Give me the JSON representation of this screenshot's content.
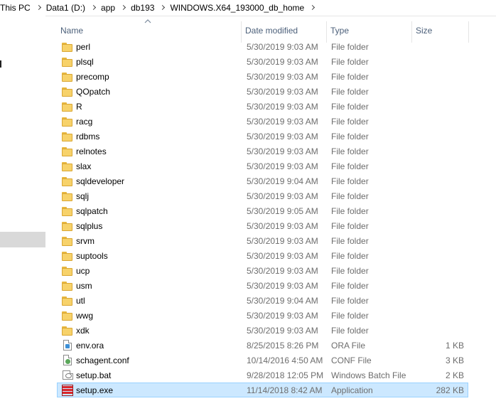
{
  "breadcrumb": [
    "This PC",
    "Data1 (D:)",
    "app",
    "db193",
    "WINDOWS.X64_193000_db_home"
  ],
  "columns": {
    "name": "Name",
    "date": "Date modified",
    "type": "Type",
    "size": "Size"
  },
  "files": [
    {
      "name": "perl",
      "date": "5/30/2019 9:03 AM",
      "type": "File folder",
      "size": "",
      "icon": "folder-icon"
    },
    {
      "name": "plsql",
      "date": "5/30/2019 9:03 AM",
      "type": "File folder",
      "size": "",
      "icon": "folder-icon"
    },
    {
      "name": "precomp",
      "date": "5/30/2019 9:03 AM",
      "type": "File folder",
      "size": "",
      "icon": "folder-icon"
    },
    {
      "name": "QOpatch",
      "date": "5/30/2019 9:03 AM",
      "type": "File folder",
      "size": "",
      "icon": "folder-icon"
    },
    {
      "name": "R",
      "date": "5/30/2019 9:03 AM",
      "type": "File folder",
      "size": "",
      "icon": "folder-icon"
    },
    {
      "name": "racg",
      "date": "5/30/2019 9:03 AM",
      "type": "File folder",
      "size": "",
      "icon": "folder-icon"
    },
    {
      "name": "rdbms",
      "date": "5/30/2019 9:03 AM",
      "type": "File folder",
      "size": "",
      "icon": "folder-icon"
    },
    {
      "name": "relnotes",
      "date": "5/30/2019 9:03 AM",
      "type": "File folder",
      "size": "",
      "icon": "folder-icon"
    },
    {
      "name": "slax",
      "date": "5/30/2019 9:03 AM",
      "type": "File folder",
      "size": "",
      "icon": "folder-icon"
    },
    {
      "name": "sqldeveloper",
      "date": "5/30/2019 9:04 AM",
      "type": "File folder",
      "size": "",
      "icon": "folder-icon"
    },
    {
      "name": "sqlj",
      "date": "5/30/2019 9:03 AM",
      "type": "File folder",
      "size": "",
      "icon": "folder-icon"
    },
    {
      "name": "sqlpatch",
      "date": "5/30/2019 9:05 AM",
      "type": "File folder",
      "size": "",
      "icon": "folder-icon"
    },
    {
      "name": "sqlplus",
      "date": "5/30/2019 9:03 AM",
      "type": "File folder",
      "size": "",
      "icon": "folder-icon"
    },
    {
      "name": "srvm",
      "date": "5/30/2019 9:03 AM",
      "type": "File folder",
      "size": "",
      "icon": "folder-icon"
    },
    {
      "name": "suptools",
      "date": "5/30/2019 9:03 AM",
      "type": "File folder",
      "size": "",
      "icon": "folder-icon"
    },
    {
      "name": "ucp",
      "date": "5/30/2019 9:03 AM",
      "type": "File folder",
      "size": "",
      "icon": "folder-icon"
    },
    {
      "name": "usm",
      "date": "5/30/2019 9:03 AM",
      "type": "File folder",
      "size": "",
      "icon": "folder-icon"
    },
    {
      "name": "utl",
      "date": "5/30/2019 9:04 AM",
      "type": "File folder",
      "size": "",
      "icon": "folder-icon"
    },
    {
      "name": "wwg",
      "date": "5/30/2019 9:03 AM",
      "type": "File folder",
      "size": "",
      "icon": "folder-icon"
    },
    {
      "name": "xdk",
      "date": "5/30/2019 9:03 AM",
      "type": "File folder",
      "size": "",
      "icon": "folder-icon"
    },
    {
      "name": "env.ora",
      "date": "8/25/2015 8:26 PM",
      "type": "ORA File",
      "size": "1 KB",
      "icon": "ora-file-icon"
    },
    {
      "name": "schagent.conf",
      "date": "10/14/2016 4:50 AM",
      "type": "CONF File",
      "size": "3 KB",
      "icon": "conf-file-icon"
    },
    {
      "name": "setup.bat",
      "date": "9/28/2018 12:05 PM",
      "type": "Windows Batch File",
      "size": "2 KB",
      "icon": "batch-file-icon"
    },
    {
      "name": "setup.exe",
      "date": "11/14/2018 8:42 AM",
      "type": "Application",
      "size": "282 KB",
      "icon": "application-icon",
      "selected": true
    }
  ],
  "colors": {
    "selection_bg": "#cce8ff",
    "selection_border": "#99d1ff",
    "header_text": "#4c607a",
    "folder": "#f7d26a"
  }
}
